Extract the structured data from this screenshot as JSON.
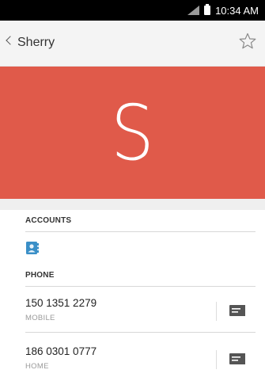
{
  "status_bar": {
    "time": "10:34 AM"
  },
  "header": {
    "back_label": "Sherry"
  },
  "hero": {
    "initial": "S",
    "color": "#e05a4a"
  },
  "sections": {
    "accounts_label": "ACCOUNTS",
    "phone_label": "PHONE"
  },
  "phones": [
    {
      "number": "150 1351 2279",
      "type": "MOBILE"
    },
    {
      "number": "186 0301 0777",
      "type": "HOME"
    }
  ]
}
